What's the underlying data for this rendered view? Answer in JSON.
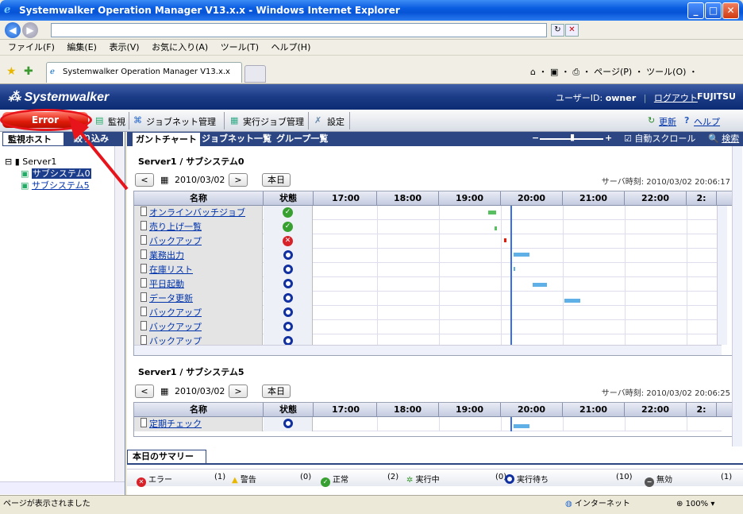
{
  "window": {
    "title": "Systemwalker Operation Manager V13.x.x - Windows Internet Explorer"
  },
  "browser": {
    "menu": [
      "ファイル(F)",
      "編集(E)",
      "表示(V)",
      "お気に入り(A)",
      "ツール(T)",
      "ヘルプ(H)"
    ],
    "tab_title": "Systemwalker Operation Manager V13.x.x",
    "tools": "ページ(P) ・ ツール(O) ・",
    "status": "ページが表示されました",
    "zone": "インターネット",
    "zoom": "100%"
  },
  "app": {
    "logo": "Systemwalker",
    "user_label": "ユーザーID:",
    "user": "owner",
    "logout": "ログアウト",
    "brand": "FUJITSU"
  },
  "toolbar": {
    "error_label": "Error",
    "monitor": "監視",
    "jobnet": "ジョブネット管理",
    "exec_job": "実行ジョブ管理",
    "settings": "設定",
    "refresh": "更新",
    "help": "ヘルプ"
  },
  "left": {
    "tab1": "監視ホスト",
    "tab2": "絞り込み",
    "tree": {
      "server": "Server1",
      "children": [
        "サブシステム0",
        "サブシステム5"
      ]
    }
  },
  "right": {
    "tabs": [
      "ガントチャート",
      "ジョブネット一覧",
      "グループ一覧"
    ],
    "autoscroll": "自動スクロール",
    "search": "検索",
    "sections": [
      {
        "title": "Server1 / サブシステム0",
        "date": "2010/03/02",
        "today": "本日",
        "server_time_label": "サーバ時刻:",
        "server_time": "2010/03/02 20:06:17",
        "headers": {
          "name": "名称",
          "status": "状態",
          "hours": [
            "17:00",
            "18:00",
            "19:00",
            "20:00",
            "21:00",
            "22:00",
            "2:"
          ]
        },
        "rows": [
          {
            "name": "オンラインバッチジョブ",
            "status": "ok"
          },
          {
            "name": "売り上げ一覧",
            "status": "ok"
          },
          {
            "name": "バックアップ",
            "status": "error"
          },
          {
            "name": "業務出力",
            "status": "waiting"
          },
          {
            "name": "在庫リスト",
            "status": "waiting"
          },
          {
            "name": "平日起動",
            "status": "waiting"
          },
          {
            "name": "データ更新",
            "status": "waiting"
          },
          {
            "name": "バックアップ",
            "status": "waiting"
          },
          {
            "name": "バックアップ",
            "status": "waiting"
          },
          {
            "name": "バックアップ",
            "status": "waiting"
          }
        ]
      },
      {
        "title": "Server1 / サブシステム5",
        "date": "2010/03/02",
        "today": "本日",
        "server_time_label": "サーバ時刻:",
        "server_time": "2010/03/02 20:06:25",
        "headers": {
          "name": "名称",
          "status": "状態",
          "hours": [
            "17:00",
            "18:00",
            "19:00",
            "20:00",
            "21:00",
            "22:00",
            "2:"
          ]
        },
        "rows": [
          {
            "name": "定期チェック",
            "status": "waiting"
          }
        ]
      }
    ],
    "summary": {
      "tab": "本日のサマリー",
      "items": [
        {
          "label": "エラー",
          "count": "(1)"
        },
        {
          "label": "警告",
          "count": "(0)"
        },
        {
          "label": "正常",
          "count": "(2)"
        },
        {
          "label": "実行中",
          "count": "(0)"
        },
        {
          "label": "実行待ち",
          "count": "(10)"
        },
        {
          "label": "無効",
          "count": "(1)"
        }
      ]
    }
  },
  "colors": {
    "error": "#e01b0a",
    "ok": "#38a030",
    "bar": "#60b0e8",
    "header": "#2b4683"
  }
}
